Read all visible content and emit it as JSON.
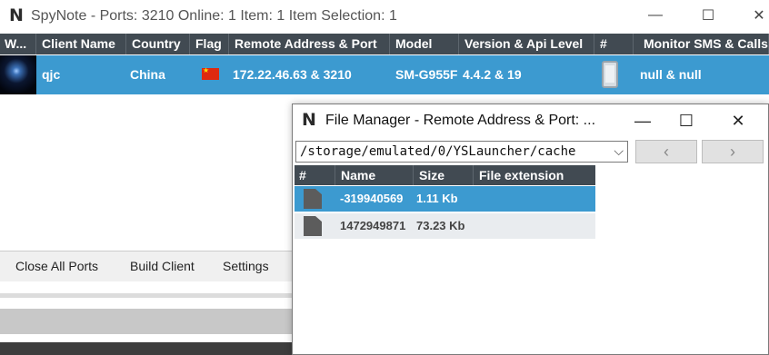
{
  "window": {
    "title": "SpyNote - Ports: 3210 Online: 1 Item: 1 Item Selection: 1",
    "logo_glyph": "N",
    "minimize_glyph": "—",
    "maximize_glyph": "☐",
    "close_glyph": "✕"
  },
  "clients_table": {
    "columns": [
      "W...",
      "Client Name",
      "Country",
      "Flag",
      "Remote Address & Port",
      "Model",
      "Version & Api Level",
      "#",
      "Monitor SMS & Calls"
    ],
    "rows": [
      {
        "client_name": "qjc",
        "country": "China",
        "flag_icon": "china-flag-icon",
        "remote_address": "172.22.46.63 & 3210",
        "model": "SM-G955F",
        "version": "4.4.2 & 19",
        "device_icon": "phone-icon",
        "monitor": "null & null"
      }
    ]
  },
  "toolbar": {
    "close_all_ports": "Close All Ports",
    "build_client": "Build Client",
    "settings": "Settings"
  },
  "file_manager": {
    "title": "File Manager - Remote Address & Port: ...",
    "logo_glyph": "N",
    "minimize_glyph": "—",
    "maximize_glyph": "☐",
    "close_glyph": "✕",
    "path": "/storage/emulated/0/YSLauncher/cache",
    "dropdown_glyph": "⌵",
    "back_glyph": "‹",
    "forward_glyph": "›",
    "columns": [
      "#",
      "Name",
      "Size",
      "File extension"
    ],
    "files": [
      {
        "name": "-319940569",
        "size": "1.11 Kb",
        "extension": "",
        "selected": true
      },
      {
        "name": "1472949871",
        "size": "73.23 Kb",
        "extension": "",
        "selected": false
      }
    ]
  },
  "colors": {
    "header_bg": "#414a52",
    "selection": "#3c9ad0"
  }
}
